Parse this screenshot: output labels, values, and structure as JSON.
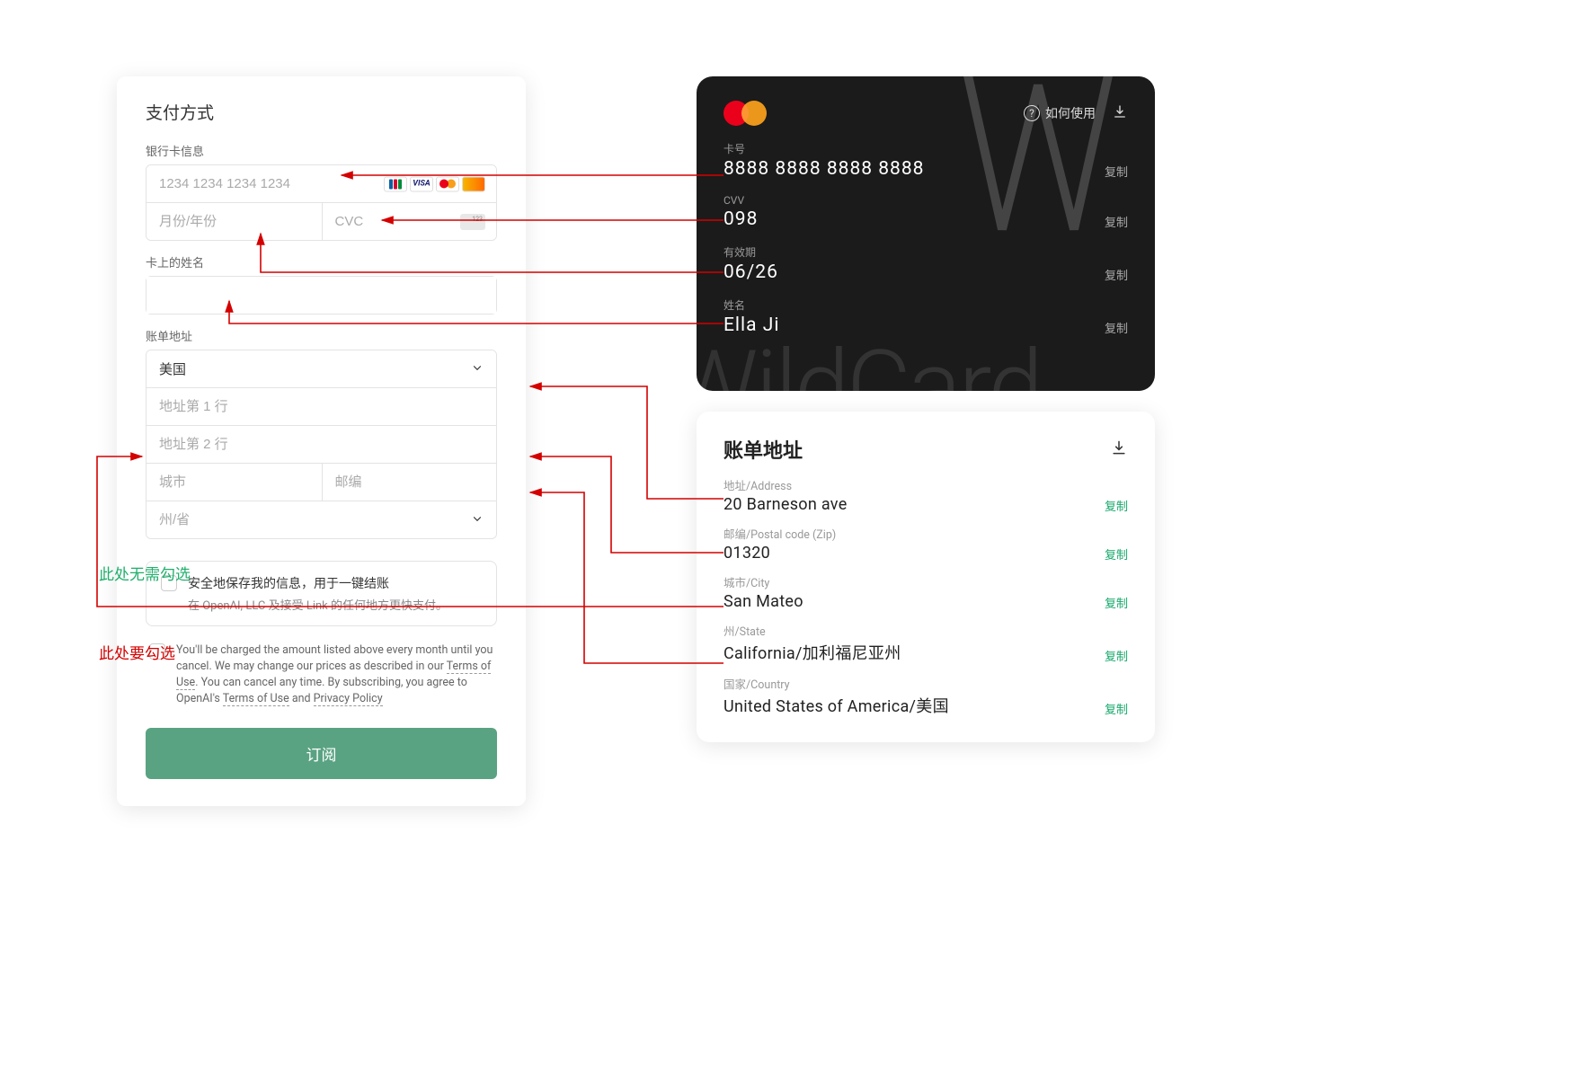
{
  "form": {
    "title": "支付方式",
    "cardInfoLabel": "银行卡信息",
    "cardPlaceholder": "1234 1234 1234 1234",
    "expiryPlaceholder": "月份/年份",
    "cvcPlaceholder": "CVC",
    "nameLabel": "卡上的姓名",
    "billingLabel": "账单地址",
    "countrySelected": "美国",
    "addr1Placeholder": "地址第 1 行",
    "addr2Placeholder": "地址第 2 行",
    "cityPlaceholder": "城市",
    "zipPlaceholder": "邮编",
    "statePlaceholder": "州/省",
    "saveTitle": "安全地保存我的信息，用于一键结账",
    "saveSub": "在 OpenAI, LLC 及接受 Link 的任何地方更快支付。",
    "terms1": "You'll be charged the amount listed above every month until you cancel. We may change our prices as described in our ",
    "termsOfUse": "Terms of Use",
    "terms2": ". You can cancel any time. By subscribing, you agree to OpenAI's ",
    "terms3": " and ",
    "privacy": "Privacy Policy",
    "subscribe": "订阅"
  },
  "vcard": {
    "howToUse": "如何使用",
    "numLabel": "卡号",
    "numVal": "8888 8888 8888 8888",
    "cvvLabel": "CVV",
    "cvvVal": "098",
    "expLabel": "有效期",
    "expVal": "06/26",
    "nameLabel": "姓名",
    "nameVal": "Ella Ji",
    "copy": "复制",
    "watermark": "WildCard"
  },
  "billing": {
    "title": "账单地址",
    "addrLabel": "地址/Address",
    "addrVal": "20 Barneson ave",
    "zipLabel": "邮编/Postal code (Zip)",
    "zipVal": "01320",
    "cityLabel": "城市/City",
    "cityVal": "San Mateo",
    "stateLabel": "州/State",
    "stateVal": "California/加利福尼亚州",
    "countryLabel": "国家/Country",
    "countryVal": "United States of America/美国",
    "copy": "复制"
  },
  "anno": {
    "noCheck": "此处无需勾选",
    "mustCheck": "此处要勾选"
  }
}
